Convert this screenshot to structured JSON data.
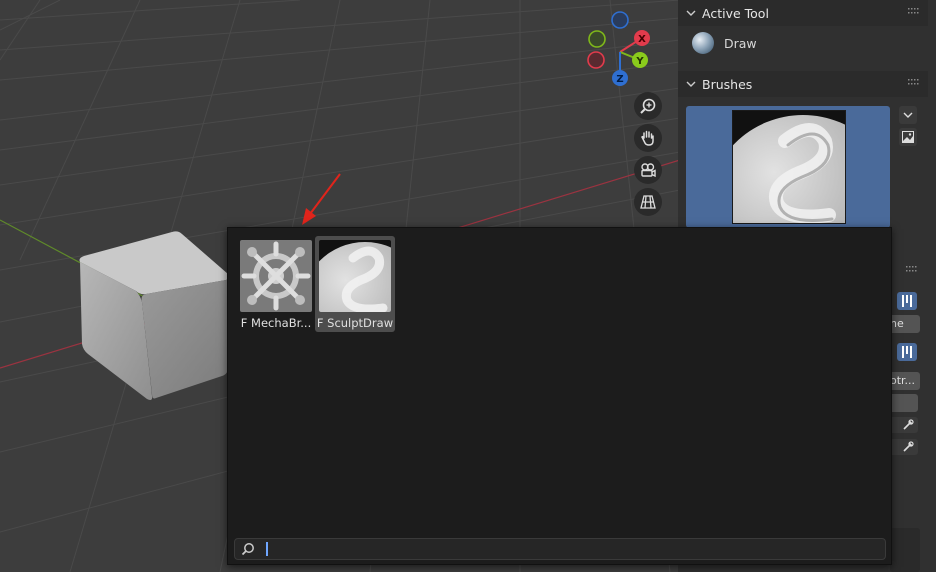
{
  "gizmo": {
    "x": "X",
    "y": "Y",
    "z": "Z"
  },
  "active_tool": {
    "header": "Active Tool",
    "tool_name": "Draw"
  },
  "brushes": {
    "header": "Brushes"
  },
  "popup": {
    "items": [
      {
        "label": "F MechaBr...",
        "icon": "mecha-brush-icon",
        "selected": false
      },
      {
        "label": "F SculptDraw",
        "icon": "sculpt-draw-icon",
        "selected": true
      }
    ],
    "search": {
      "value": "",
      "placeholder": ""
    }
  },
  "partial_labels": {
    "field_1": "he",
    "field_2": "otr..."
  },
  "colors": {
    "accent_blue": "#4a6a9a",
    "axis_red": "#e23b4c",
    "axis_green": "#7fb81a",
    "axis_blue": "#2f6fd1",
    "arrow_red": "#e0241b"
  }
}
